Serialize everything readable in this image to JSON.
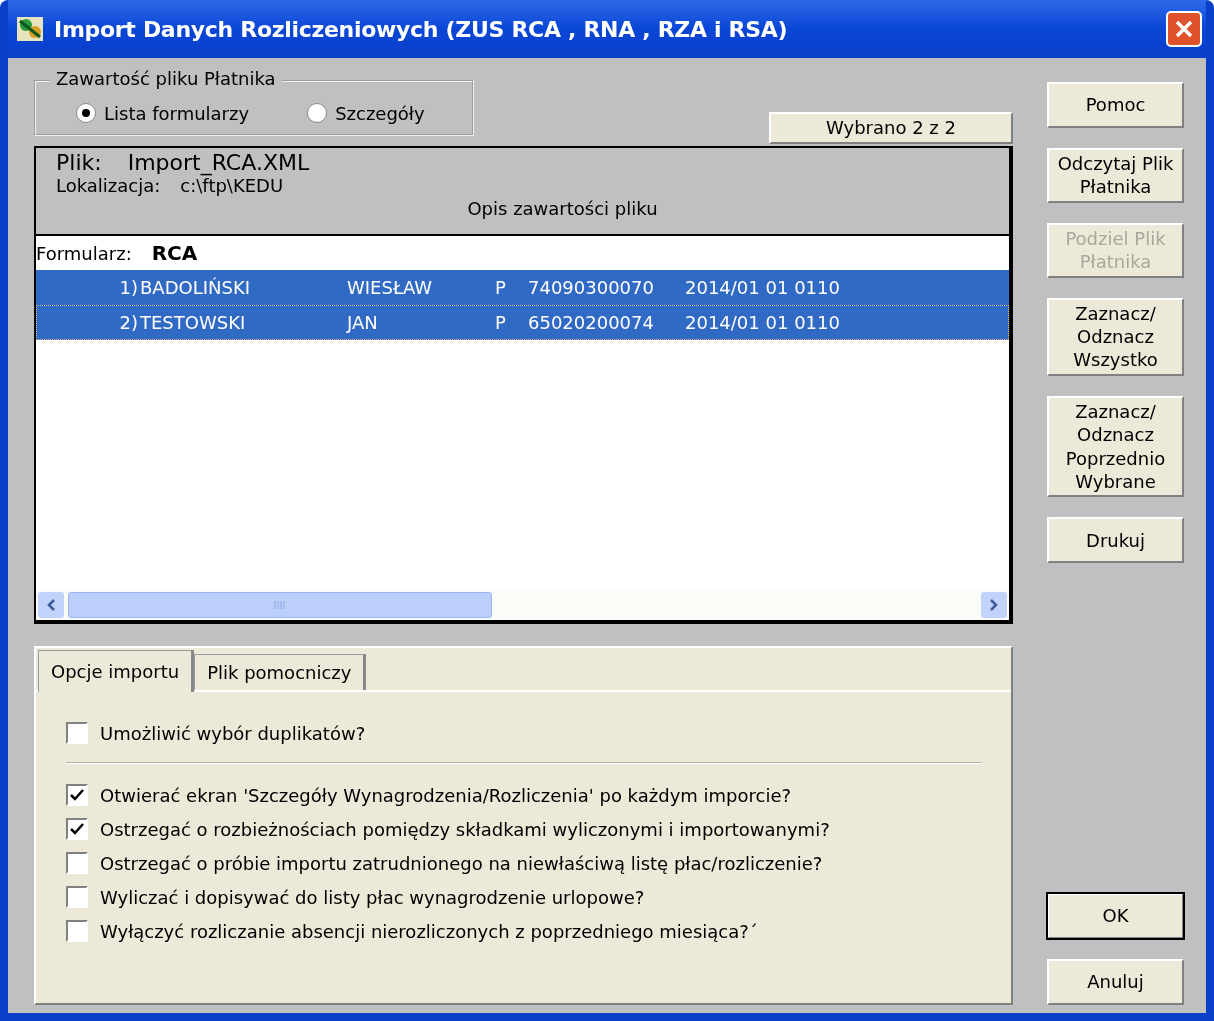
{
  "window": {
    "title": "Import Danych Rozliczeniowych (ZUS RCA , RNA , RZA i RSA)"
  },
  "content_group": {
    "label": "Zawartość pliku Płatnika",
    "options": [
      {
        "label": "Lista formularzy",
        "selected": true
      },
      {
        "label": "Szczegóły",
        "selected": false
      }
    ]
  },
  "selection_count": "Wybrano 2 z 2",
  "file": {
    "file_label": "Plik:",
    "file_name": "Import_RCA.XML",
    "location_label": "Lokalizacja:",
    "location": "c:\\ftp\\KEDU",
    "description_header": "Opis zawartości pliku"
  },
  "list": {
    "form_label": "Formularz:",
    "form_name": "RCA",
    "rows": [
      {
        "number": "1)",
        "surname": "BADOLIŃSKI",
        "first_name": "WIESŁAW",
        "code": "P",
        "id_number": "74090300070",
        "period": "2014/01 01 0110",
        "selected": true,
        "focused": false
      },
      {
        "number": "2)",
        "surname": "TESTOWSKI",
        "first_name": "JAN",
        "code": "P",
        "id_number": "65020200074",
        "period": "2014/01 01 0110",
        "selected": true,
        "focused": true
      }
    ]
  },
  "tabs": [
    {
      "label": "Opcje importu",
      "selected": true
    },
    {
      "label": "Plik pomocniczy",
      "selected": false
    }
  ],
  "option_groups": [
    {
      "options": [
        {
          "label": "Umożliwić wybór duplikatów?",
          "checked": false
        }
      ]
    },
    {
      "options": [
        {
          "label": "Otwierać ekran 'Szczegóły Wynagrodzenia/Rozliczenia' po każdym imporcie?",
          "checked": true
        },
        {
          "label": "Ostrzegać o rozbieżnościach pomiędzy składkami wyliczonymi i importowanymi?",
          "checked": true
        },
        {
          "label": "Ostrzegać o próbie importu zatrudnionego na niewłaściwą listę płac/rozliczenie?",
          "checked": false
        },
        {
          "label": "Wyliczać i dopisywać do listy płac wynagrodzenie urlopowe?",
          "checked": false
        },
        {
          "label": "Wyłączyć rozliczanie absencji nierozliczonych z poprzedniego miesiąca?´",
          "checked": false
        }
      ]
    }
  ],
  "side_buttons": [
    {
      "lines": [
        "Pomoc"
      ],
      "disabled": false
    },
    {
      "lines": [
        "Odczytaj Plik",
        "Płatnika"
      ],
      "disabled": false
    },
    {
      "lines": [
        "Podziel Plik",
        "Płatnika"
      ],
      "disabled": true
    },
    {
      "lines": [
        "Zaznacz/",
        "Odznacz",
        "Wszystko"
      ],
      "disabled": false
    },
    {
      "lines": [
        "Zaznacz/",
        "Odznacz",
        "Poprzednio",
        "Wybrane"
      ],
      "disabled": false
    },
    {
      "lines": [
        "Drukuj"
      ],
      "disabled": false
    }
  ],
  "dialog_buttons": [
    {
      "label": "OK",
      "kind": "default"
    },
    {
      "label": "Anuluj",
      "kind": "normal"
    }
  ]
}
